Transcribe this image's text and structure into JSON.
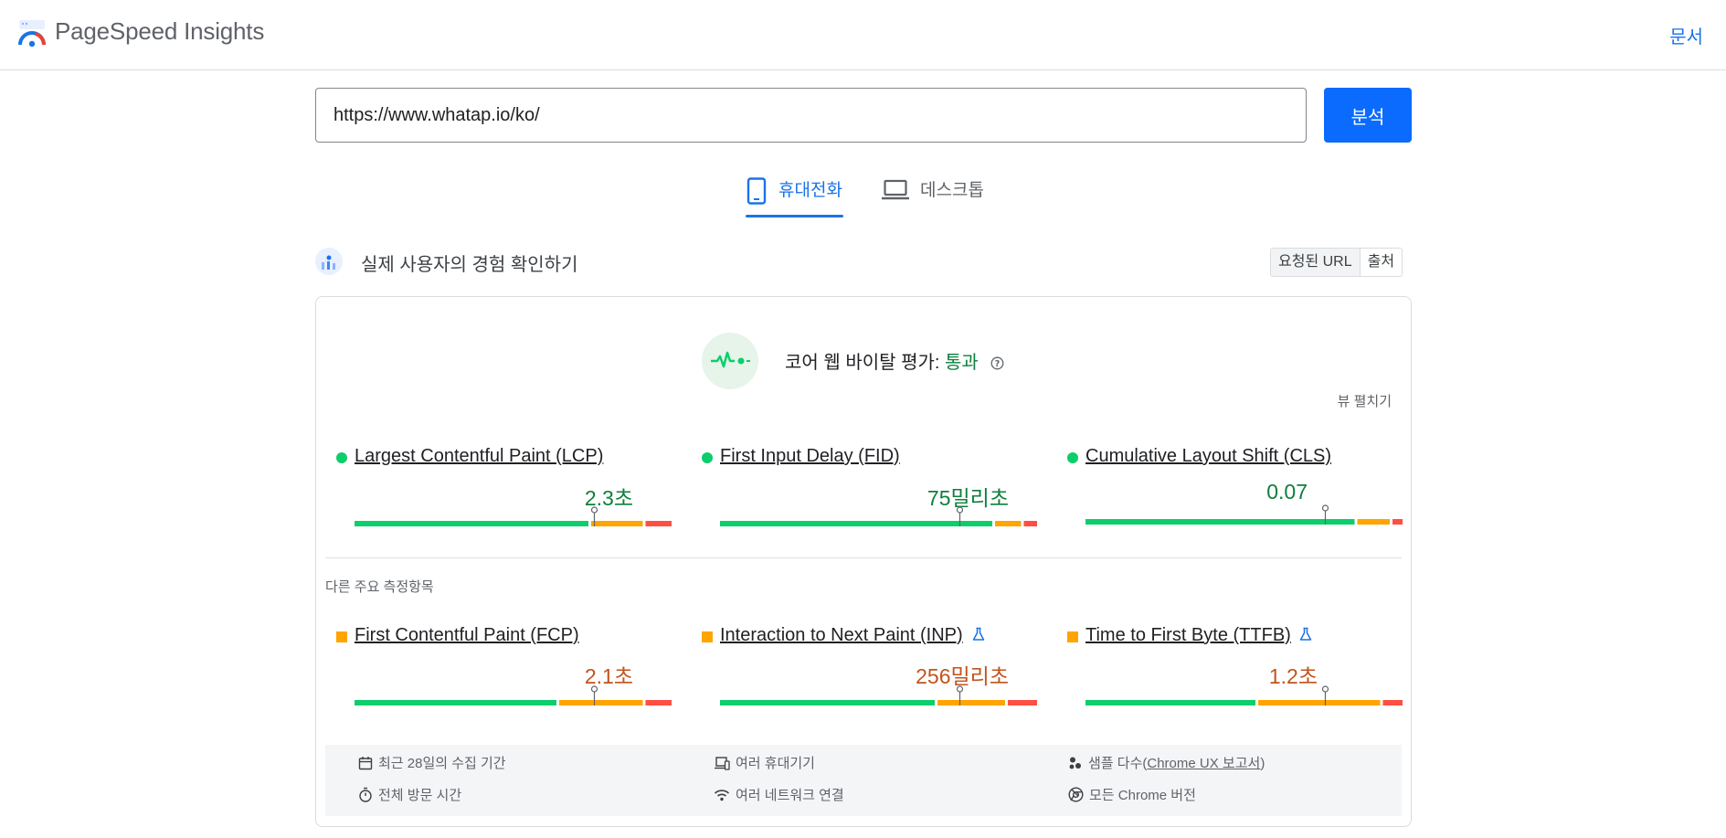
{
  "header": {
    "title": "PageSpeed Insights",
    "docs_link": "문서"
  },
  "search": {
    "url_value": "https://www.whatap.io/ko/",
    "analyze_label": "분석"
  },
  "tabs": [
    {
      "label": "휴대전화",
      "selected": true
    },
    {
      "label": "데스크톱",
      "selected": false
    }
  ],
  "field_section": {
    "title": "실제 사용자의 경험 확인하기",
    "toggle": {
      "url_label": "요청된 URL",
      "origin_label": "출처"
    }
  },
  "assessment": {
    "label": "코어 웹 바이탈 평가:",
    "result": "통과",
    "expand_label": "뷰 펼치기"
  },
  "core_metrics": [
    {
      "name": "Largest Contentful Paint (LCP)",
      "value": "2.3초",
      "status": "good",
      "distribution": [
        74,
        17,
        9
      ]
    },
    {
      "name": "First Input Delay (FID)",
      "value": "75밀리초",
      "status": "good",
      "distribution": [
        86,
        9,
        5
      ]
    },
    {
      "name": "Cumulative Layout Shift (CLS)",
      "value": "0.07",
      "status": "good",
      "distribution": [
        85,
        11,
        4
      ]
    }
  ],
  "other_label": "다른 주요 측정항목",
  "other_metrics": [
    {
      "name": "First Contentful Paint (FCP)",
      "value": "2.1초",
      "status": "average",
      "experimental": false,
      "distribution": [
        64,
        27,
        9
      ]
    },
    {
      "name": "Interaction to Next Paint (INP)",
      "value": "256밀리초",
      "status": "average",
      "experimental": true,
      "distribution": [
        68,
        22,
        10
      ]
    },
    {
      "name": "Time to First Byte (TTFB)",
      "value": "1.2초",
      "status": "average",
      "experimental": true,
      "distribution": [
        54,
        39,
        7
      ]
    }
  ],
  "footer": {
    "period": "최근 28일의 수집 기간",
    "devices": "여러 휴대기기",
    "samples_prefix": "샘플 다수(",
    "samples_link": "Chrome UX 보고서",
    "samples_suffix": ")",
    "visit": "전체 방문 시간",
    "network": "여러 네트워크 연결",
    "chrome": "모든 Chrome 버전"
  },
  "colors": {
    "accent": "#1a73e8",
    "good": "#0cce6b",
    "average": "#ffa400",
    "poor": "#ff4e42",
    "good_text": "#0d7f3c",
    "average_text": "#c1541d"
  }
}
